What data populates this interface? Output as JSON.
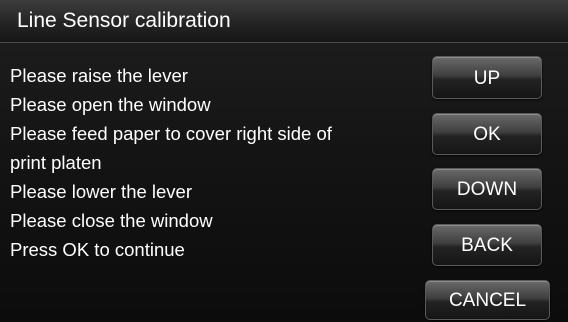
{
  "header": {
    "title": "Line Sensor calibration"
  },
  "instructions": [
    "Please raise the lever",
    "Please open the window",
    "Please feed paper to cover right side of",
    "print platen",
    "Please lower the lever",
    "Please close the window",
    "Press OK to continue"
  ],
  "buttons": {
    "up": "UP",
    "ok": "OK",
    "down": "DOWN",
    "back": "BACK",
    "cancel": "CANCEL"
  },
  "colors": {
    "background": "#000000",
    "text": "#ffffff",
    "button_top": "#6a6a6a",
    "button_bottom": "#151515"
  }
}
